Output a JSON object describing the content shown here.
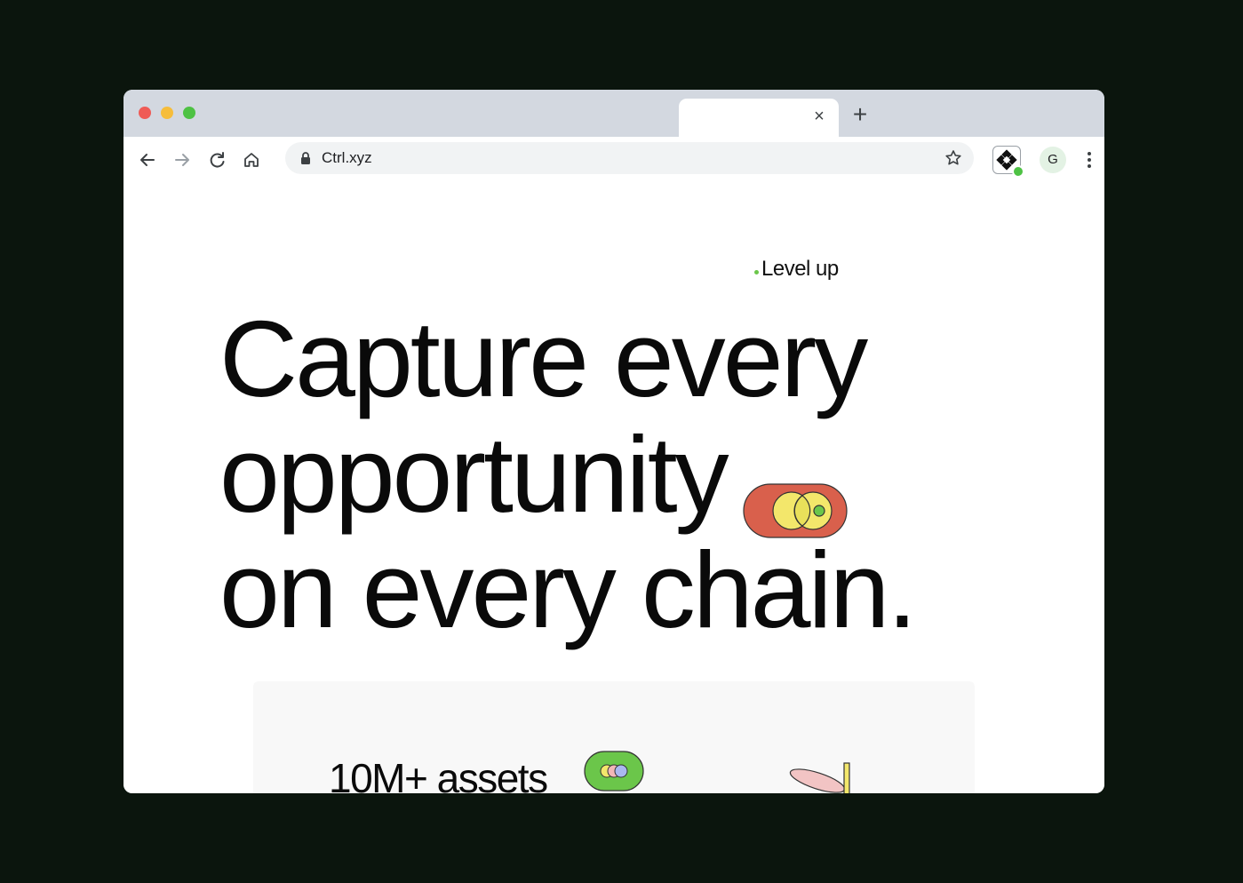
{
  "browser": {
    "window_controls": [
      "close",
      "minimize",
      "maximize"
    ],
    "tab": {
      "close_icon": "close-icon"
    },
    "new_tab_label": "+",
    "address": {
      "url": "Ctrl.xyz",
      "lock_icon": "lock-icon",
      "bookmark_icon": "star-icon"
    },
    "nav_icons": [
      "back-arrow-icon",
      "forward-arrow-icon",
      "reload-icon",
      "home-icon"
    ],
    "extension_icon": "ctrl-extension-icon",
    "profile_initial": "G",
    "menu_icon": "kebab-menu-icon"
  },
  "hero": {
    "eyebrow": "Level up",
    "headline_line1": "Capture every",
    "headline_line2": "opportunity",
    "headline_line3": "on every chain."
  },
  "card": {
    "title": "10M+ assets"
  },
  "colors": {
    "page_bg": "#0b150d",
    "titlebar": "#d3d8e0",
    "accent_green": "#6bc64a",
    "pill_red": "#d9604c",
    "pill_yellow": "#f3e76b"
  }
}
